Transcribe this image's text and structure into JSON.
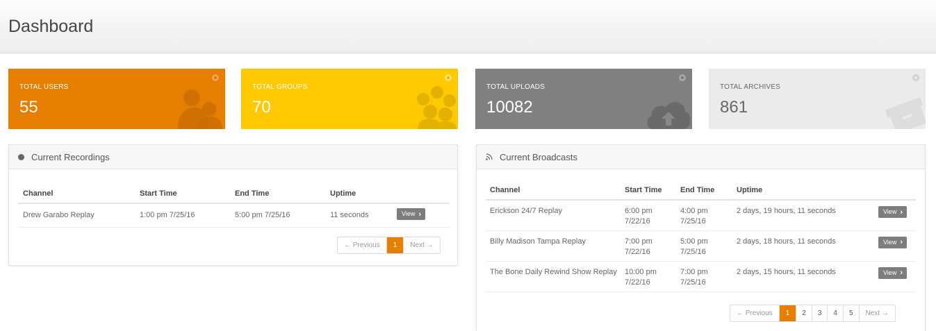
{
  "page": {
    "title": "Dashboard"
  },
  "stats": [
    {
      "label": "TOTAL USERS",
      "value": "55",
      "icon": "users-icon",
      "color": "#e67e00"
    },
    {
      "label": "TOTAL GROUPS",
      "value": "70",
      "icon": "groups-icon",
      "color": "#ffc900"
    },
    {
      "label": "TOTAL UPLOADS",
      "value": "10082",
      "icon": "cloud-upload-icon",
      "color": "#808080"
    },
    {
      "label": "TOTAL ARCHIVES",
      "value": "861",
      "icon": "archive-box-icon",
      "color": "#ebebeb"
    }
  ],
  "recordings": {
    "title": "Current Recordings",
    "columns": [
      "Channel",
      "Start Time",
      "End Time",
      "Uptime"
    ],
    "rows": [
      {
        "channel": "Drew Garabo Replay",
        "start": "1:00 pm 7/25/16",
        "end": "5:00 pm 7/25/16",
        "uptime": "11 seconds",
        "action": "View"
      }
    ],
    "pagination": {
      "prev": "← Previous",
      "pages": [
        "1"
      ],
      "active": "1",
      "next": "Next →"
    }
  },
  "broadcasts": {
    "title": "Current Broadcasts",
    "columns": [
      "Channel",
      "Start Time",
      "End Time",
      "Uptime"
    ],
    "rows": [
      {
        "channel": "Erickson 24/7 Replay",
        "start_time": "6:00 pm",
        "start_date": "7/22/16",
        "end_time": "4:00 pm",
        "end_date": "7/25/16",
        "uptime": "2 days, 19 hours, 11 seconds",
        "action": "View"
      },
      {
        "channel": "Billy Madison Tampa Replay",
        "start_time": "7:00 pm",
        "start_date": "7/22/16",
        "end_time": "5:00 pm",
        "end_date": "7/25/16",
        "uptime": "2 days, 18 hours, 11 seconds",
        "action": "View"
      },
      {
        "channel": "The Bone Daily Rewind Show Replay",
        "start_time": "10:00 pm",
        "start_date": "7/22/16",
        "end_time": "7:00 pm",
        "end_date": "7/25/16",
        "uptime": "2 days, 15 hours, 11 seconds",
        "action": "View"
      }
    ],
    "pagination": {
      "prev": "← Previous",
      "pages": [
        "1",
        "2",
        "3",
        "4",
        "5"
      ],
      "active": "1",
      "next": "Next →"
    }
  },
  "colors": {
    "accent": "#e67e00",
    "button": "#7d7d7d"
  }
}
